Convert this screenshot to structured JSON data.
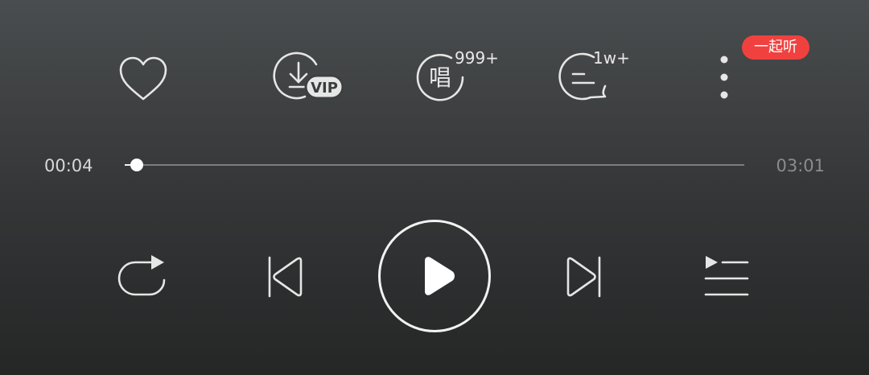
{
  "actions": {
    "like": {
      "icon": "heart-icon"
    },
    "download": {
      "icon": "download-icon",
      "badge": "VIP"
    },
    "sing": {
      "icon": "sing-icon",
      "glyph": "唱",
      "count": "999+"
    },
    "comment": {
      "icon": "comment-icon",
      "count": "1w+"
    },
    "more": {
      "icon": "more-vertical-icon",
      "badge": "一起听"
    }
  },
  "progress": {
    "current_time": "00:04",
    "total_time": "03:01",
    "fraction": 0.02
  },
  "controls": {
    "repeat": {
      "icon": "repeat-icon"
    },
    "previous": {
      "icon": "skip-previous-icon"
    },
    "play": {
      "icon": "play-icon"
    },
    "next": {
      "icon": "skip-next-icon"
    },
    "playlist": {
      "icon": "playlist-icon"
    }
  },
  "colors": {
    "accent_badge": "#f0413f",
    "icon": "#e6e6e6",
    "track": "#7b7d7e",
    "total_time": "#8c8c8c"
  }
}
